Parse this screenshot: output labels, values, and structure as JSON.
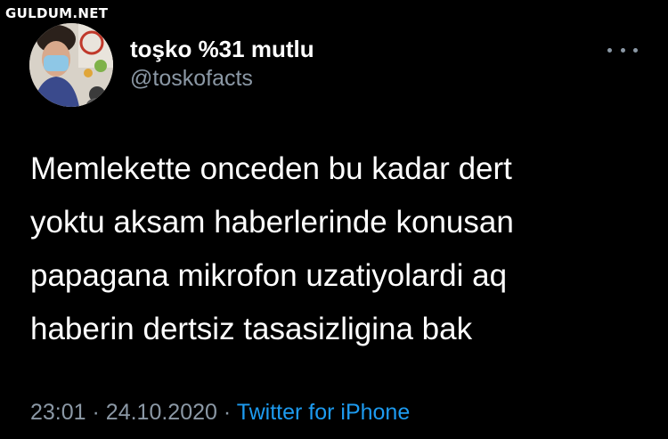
{
  "watermark": "GULDUM.NET",
  "tweet": {
    "display_name": "toşko %31 mutlu",
    "handle": "@toskofacts",
    "more_icon": "more-horizontal-icon",
    "text_lines": [
      "Memlekette onceden bu kadar dert",
      "yoktu aksam haberlerinde konusan",
      "papagana mikrofon uzatiyolardi aq",
      "haberin dertsiz tasasizligina bak"
    ],
    "time": "23:01",
    "separator": "·",
    "date": "24.10.2020",
    "source": "Twitter for iPhone"
  },
  "colors": {
    "background": "#000000",
    "text": "#ffffff",
    "secondary": "#8b98a5",
    "link": "#1d9bf0"
  }
}
